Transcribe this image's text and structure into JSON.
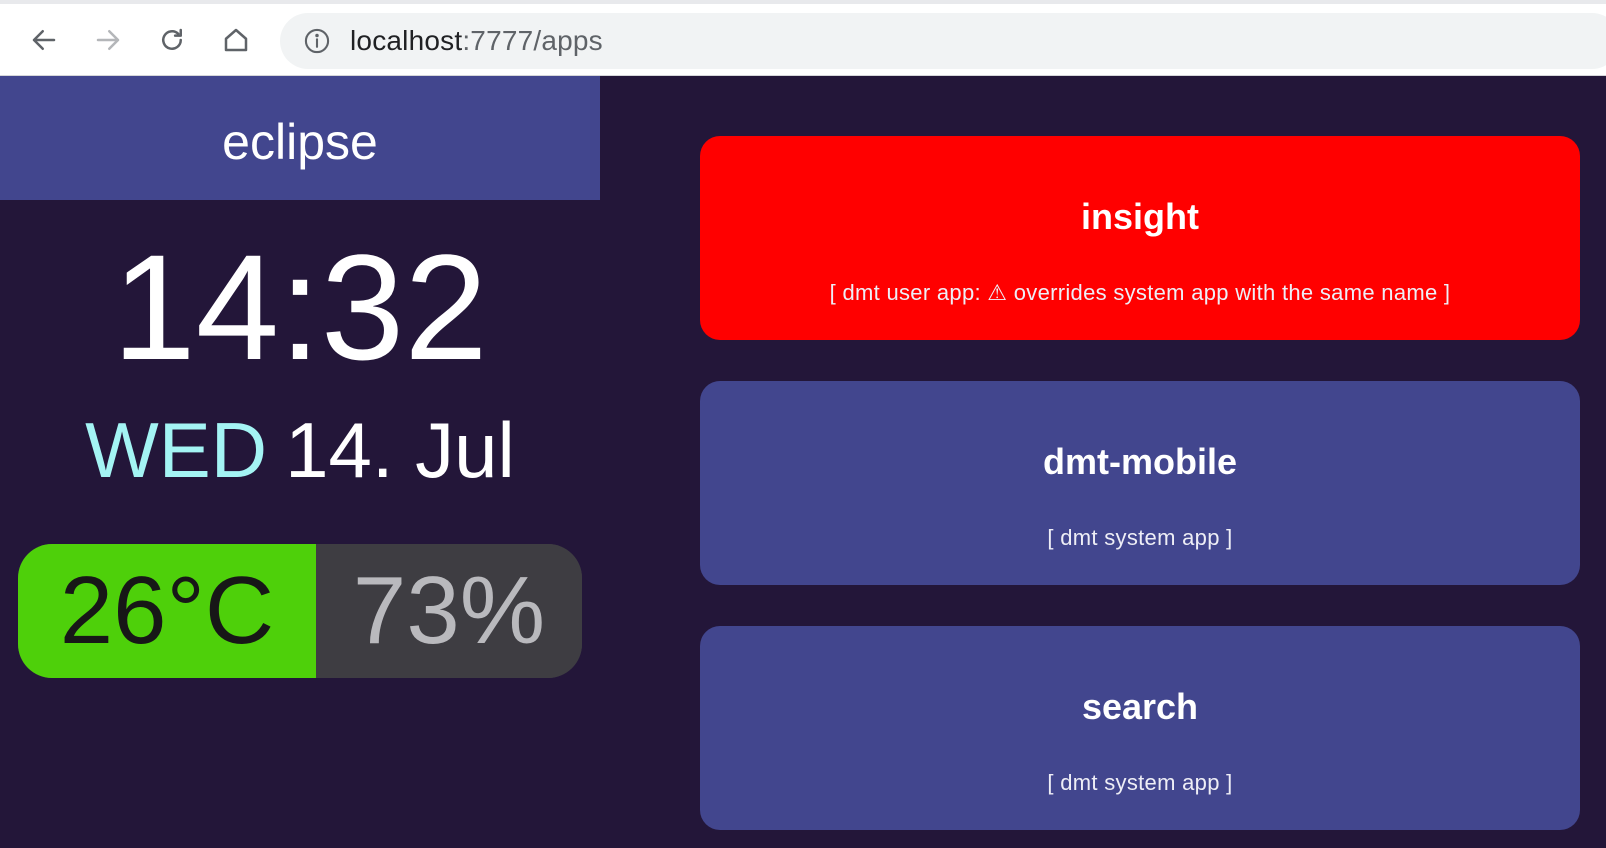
{
  "browser": {
    "url_host": "localhost",
    "url_path": ":7777/apps"
  },
  "device": {
    "name": "eclipse"
  },
  "clock": {
    "time": "14:32",
    "weekday": "WED",
    "date": "14. Jul"
  },
  "environment": {
    "temperature": "26°C",
    "humidity": "73%",
    "temperature_color": "#4ed00a"
  },
  "apps": [
    {
      "name": "insight",
      "description": "[ dmt user app: ⚠ overrides system app with the same name ]",
      "color": "#ff0000"
    },
    {
      "name": "dmt-mobile",
      "description": "[ dmt system app ]",
      "color": "#42468e"
    },
    {
      "name": "search",
      "description": "[ dmt system app ]",
      "color": "#42468e"
    }
  ],
  "icons": {
    "back": "arrow-left-icon",
    "forward": "arrow-right-icon",
    "reload": "reload-icon",
    "home": "home-icon",
    "site_info": "info-icon"
  }
}
